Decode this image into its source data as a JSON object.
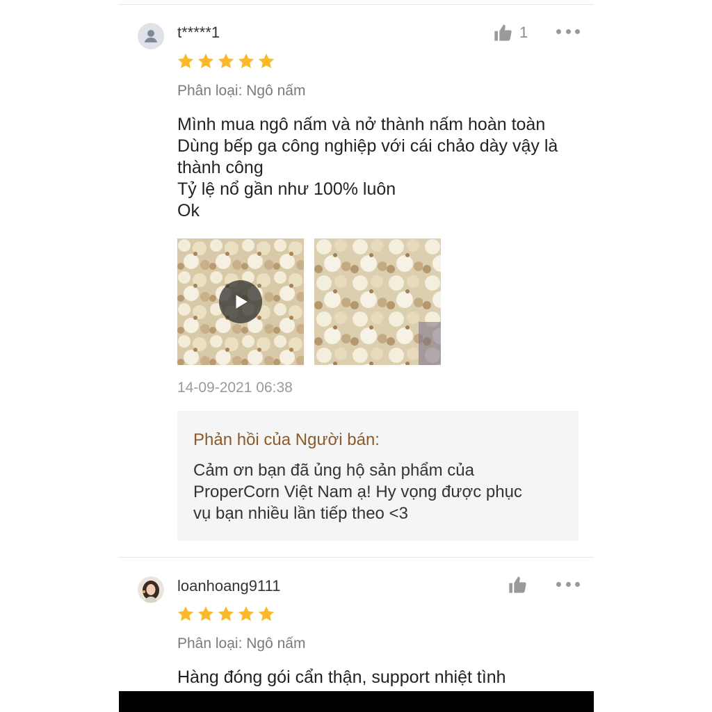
{
  "reviews": [
    {
      "username": "t*****1",
      "avatar_icon": "default-user-icon",
      "like_count": "1",
      "rating": 5,
      "variation": "Phân loại: Ngô nấm",
      "comment": "Mình mua ngô nấm và nở thành nấm hoàn toàn\nDùng bếp ga công nghiệp với cái chảo dày vậy là\nthành công\nTỷ lệ nổ gần như 100% luôn\nOk",
      "media": [
        {
          "type": "video",
          "icon": "play-icon"
        },
        {
          "type": "image"
        }
      ],
      "date": "14-09-2021 06:38",
      "seller_reply": {
        "title": "Phản hồi của Người bán:",
        "text": "Cảm ơn bạn đã ủng hộ sản phẩm của\nProperCorn Việt Nam ạ! Hy vọng được phục\nvụ bạn nhiều lần tiếp theo <3"
      }
    },
    {
      "username": "loanhoang9111",
      "avatar_icon": "user-photo",
      "like_count": "",
      "rating": 5,
      "variation": "Phân loại: Ngô nấm",
      "comment": "Hàng đóng gói cẩn thận, support nhiệt tình"
    }
  ],
  "colors": {
    "star": "#fbb829",
    "reply_title": "#8b5a2b",
    "reply_bg": "#f5f5f5",
    "muted_text": "#7a7a7a",
    "icon_gray": "#999999"
  }
}
